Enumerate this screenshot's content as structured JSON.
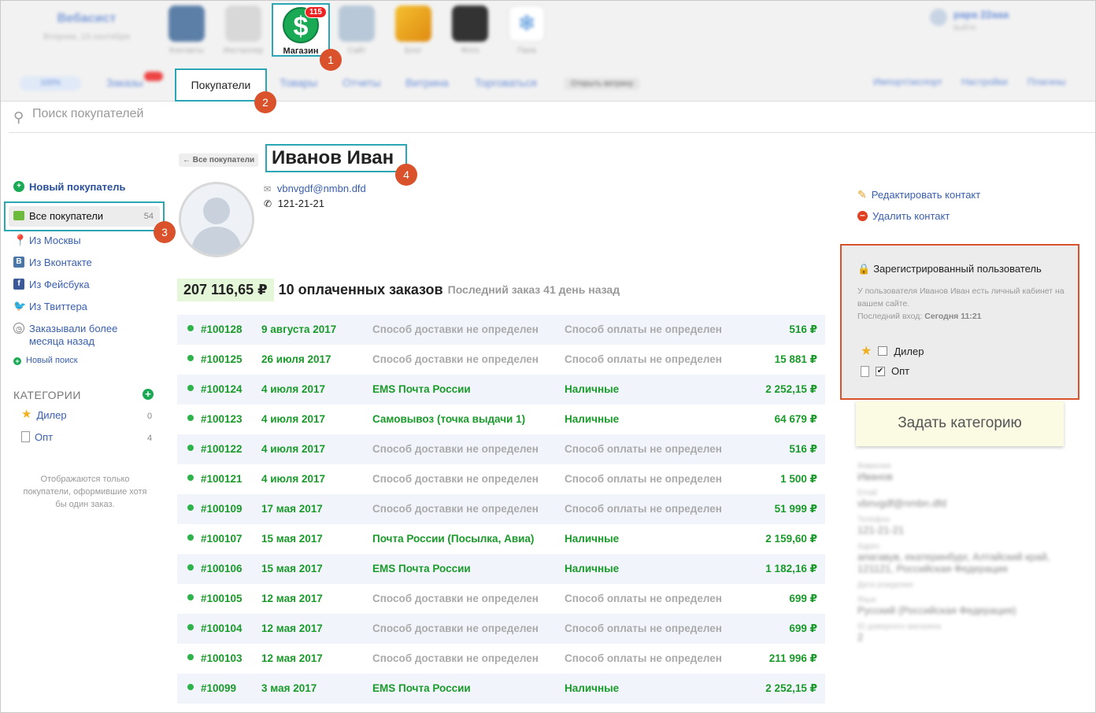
{
  "header": {
    "account_name": "Вебасист",
    "account_date": "Вторник, 19 сентября",
    "apps": [
      {
        "label": "Контакты",
        "icon": "contacts-icon"
      },
      {
        "label": "Инсталлер",
        "icon": "installer-icon"
      },
      {
        "label": "Магазин",
        "icon": "shop-icon",
        "badge": "115"
      },
      {
        "label": "Сайт",
        "icon": "site-icon"
      },
      {
        "label": "Блог",
        "icon": "blog-icon"
      },
      {
        "label": "Фото",
        "icon": "photo-icon"
      },
      {
        "label": "Папа",
        "icon": "snowflake-icon"
      }
    ],
    "user_name": "papa 22aaa",
    "user_sub": "выйти"
  },
  "tabs": {
    "progress": "100%",
    "items": [
      "Заказы",
      "Покупатели",
      "Товары",
      "Отчеты",
      "Витрина",
      "Торговаться"
    ],
    "open_store": "Открыть витрину",
    "right": [
      "Импорт/экспорт",
      "Настройки",
      "Плагины"
    ]
  },
  "search": {
    "placeholder": "Поиск покупателей"
  },
  "sidebar": {
    "new_customer": "Новый покупатель",
    "all_customers": "Все покупатели",
    "all_count": "54",
    "filters": [
      "Из Москвы",
      "Из Вконтакте",
      "Из Фейсбука",
      "Из Твиттера",
      "Заказывали более месяца назад"
    ],
    "new_search": "Новый поиск",
    "categories_title": "КАТЕГОРИИ",
    "categories": [
      {
        "name": "Дилер",
        "count": "0"
      },
      {
        "name": "Опт",
        "count": "4"
      }
    ],
    "note": "Отображаются только покупатели, оформившие хотя бы один заказ."
  },
  "customer": {
    "back": "← Все покупатели",
    "name": "Иванов Иван",
    "email": "vbnvgdf@nmbn.dfd",
    "phone": "121-21-21",
    "total": "207 116,65 ₽",
    "paid_orders": "10 оплаченных заказов",
    "last_order": "Последний заказ 41 день назад"
  },
  "orders": [
    {
      "id": "#100128",
      "date": "9 августа 2017",
      "delivery": "Способ доставки не определен",
      "payment": "Способ оплаты не определен",
      "amount": "516 ₽",
      "muted": true
    },
    {
      "id": "#100125",
      "date": "26 июля 2017",
      "delivery": "Способ доставки не определен",
      "payment": "Способ оплаты не определен",
      "amount": "15 881 ₽",
      "muted": true
    },
    {
      "id": "#100124",
      "date": "4 июля 2017",
      "delivery": "EMS Почта России",
      "payment": "Наличные",
      "amount": "2 252,15 ₽",
      "muted": false
    },
    {
      "id": "#100123",
      "date": "4 июля 2017",
      "delivery": "Самовывоз (точка выдачи 1)",
      "payment": "Наличные",
      "amount": "64 679 ₽",
      "muted": false
    },
    {
      "id": "#100122",
      "date": "4 июля 2017",
      "delivery": "Способ доставки не определен",
      "payment": "Способ оплаты не определен",
      "amount": "516 ₽",
      "muted": true
    },
    {
      "id": "#100121",
      "date": "4 июля 2017",
      "delivery": "Способ доставки не определен",
      "payment": "Способ оплаты не определен",
      "amount": "1 500 ₽",
      "muted": true
    },
    {
      "id": "#100109",
      "date": "17 мая 2017",
      "delivery": "Способ доставки не определен",
      "payment": "Способ оплаты не определен",
      "amount": "51 999 ₽",
      "muted": true
    },
    {
      "id": "#100107",
      "date": "15 мая 2017",
      "delivery": "Почта России (Посылка, Авиа)",
      "payment": "Наличные",
      "amount": "2 159,60 ₽",
      "muted": false
    },
    {
      "id": "#100106",
      "date": "15 мая 2017",
      "delivery": "EMS Почта России",
      "payment": "Наличные",
      "amount": "1 182,16 ₽",
      "muted": false
    },
    {
      "id": "#100105",
      "date": "12 мая 2017",
      "delivery": "Способ доставки не определен",
      "payment": "Способ оплаты не определен",
      "amount": "699 ₽",
      "muted": true
    },
    {
      "id": "#100104",
      "date": "12 мая 2017",
      "delivery": "Способ доставки не определен",
      "payment": "Способ оплаты не определен",
      "amount": "699 ₽",
      "muted": true
    },
    {
      "id": "#100103",
      "date": "12 мая 2017",
      "delivery": "Способ доставки не определен",
      "payment": "Способ оплаты не определен",
      "amount": "211 996 ₽",
      "muted": true
    },
    {
      "id": "#10099",
      "date": "3 мая 2017",
      "delivery": "EMS Почта России",
      "payment": "Наличные",
      "amount": "2 252,15 ₽",
      "muted": false
    }
  ],
  "actions": {
    "edit": "Редактировать контакт",
    "delete": "Удалить контакт"
  },
  "registered": {
    "title": "Зарегистрированный пользователь",
    "text": "У пользователя Иванов Иван есть личный кабинет на вашем сайте.",
    "last_login_label": "Последний вход:",
    "last_login": "Сегодня 11:21",
    "categories": [
      {
        "name": "Дилер",
        "checked": false
      },
      {
        "name": "Опт",
        "checked": true
      }
    ],
    "set_category": "Задать категорию"
  },
  "details": [
    {
      "label": "Фамилия",
      "value": "Иванов"
    },
    {
      "label": "Email",
      "value": "vbnvgdf@nmbn.dfd"
    },
    {
      "label": "Телефон",
      "value": "121-21-21"
    },
    {
      "label": "Адрес",
      "value": "апагавув, екатеринбург, Алтайский край, 121121, Российская Федерация"
    },
    {
      "label": "Дата рождения",
      "value": ""
    },
    {
      "label": "Язык",
      "value": "Русский (Российская Федерация)"
    },
    {
      "label": "ID доверного магазина",
      "value": "2"
    }
  ],
  "callouts": [
    "1",
    "2",
    "3",
    "4"
  ],
  "colors": {
    "accent": "#2aa6b5",
    "callout": "#d9522c",
    "green": "#1a9a2a",
    "link": "#3a5fb0"
  }
}
